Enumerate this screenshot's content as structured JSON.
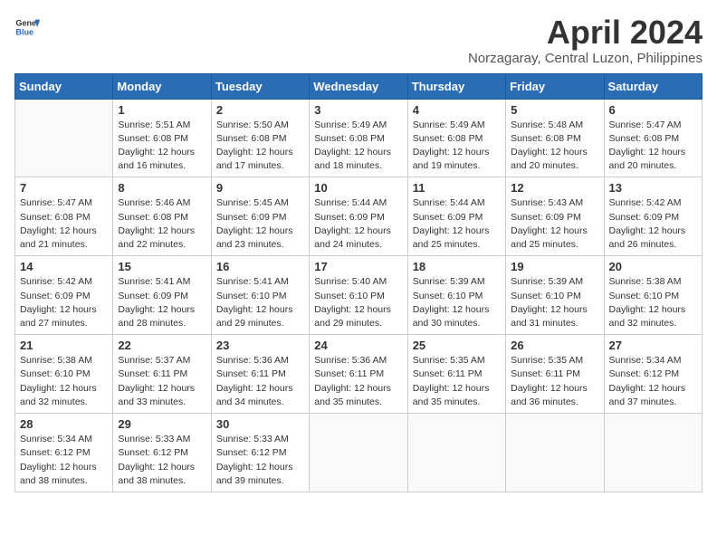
{
  "header": {
    "logo_general": "General",
    "logo_blue": "Blue",
    "month_title": "April 2024",
    "location": "Norzagaray, Central Luzon, Philippines"
  },
  "days_of_week": [
    "Sunday",
    "Monday",
    "Tuesday",
    "Wednesday",
    "Thursday",
    "Friday",
    "Saturday"
  ],
  "weeks": [
    [
      {
        "day": "",
        "info": ""
      },
      {
        "day": "1",
        "info": "Sunrise: 5:51 AM\nSunset: 6:08 PM\nDaylight: 12 hours\nand 16 minutes."
      },
      {
        "day": "2",
        "info": "Sunrise: 5:50 AM\nSunset: 6:08 PM\nDaylight: 12 hours\nand 17 minutes."
      },
      {
        "day": "3",
        "info": "Sunrise: 5:49 AM\nSunset: 6:08 PM\nDaylight: 12 hours\nand 18 minutes."
      },
      {
        "day": "4",
        "info": "Sunrise: 5:49 AM\nSunset: 6:08 PM\nDaylight: 12 hours\nand 19 minutes."
      },
      {
        "day": "5",
        "info": "Sunrise: 5:48 AM\nSunset: 6:08 PM\nDaylight: 12 hours\nand 20 minutes."
      },
      {
        "day": "6",
        "info": "Sunrise: 5:47 AM\nSunset: 6:08 PM\nDaylight: 12 hours\nand 20 minutes."
      }
    ],
    [
      {
        "day": "7",
        "info": "Sunrise: 5:47 AM\nSunset: 6:08 PM\nDaylight: 12 hours\nand 21 minutes."
      },
      {
        "day": "8",
        "info": "Sunrise: 5:46 AM\nSunset: 6:08 PM\nDaylight: 12 hours\nand 22 minutes."
      },
      {
        "day": "9",
        "info": "Sunrise: 5:45 AM\nSunset: 6:09 PM\nDaylight: 12 hours\nand 23 minutes."
      },
      {
        "day": "10",
        "info": "Sunrise: 5:44 AM\nSunset: 6:09 PM\nDaylight: 12 hours\nand 24 minutes."
      },
      {
        "day": "11",
        "info": "Sunrise: 5:44 AM\nSunset: 6:09 PM\nDaylight: 12 hours\nand 25 minutes."
      },
      {
        "day": "12",
        "info": "Sunrise: 5:43 AM\nSunset: 6:09 PM\nDaylight: 12 hours\nand 25 minutes."
      },
      {
        "day": "13",
        "info": "Sunrise: 5:42 AM\nSunset: 6:09 PM\nDaylight: 12 hours\nand 26 minutes."
      }
    ],
    [
      {
        "day": "14",
        "info": "Sunrise: 5:42 AM\nSunset: 6:09 PM\nDaylight: 12 hours\nand 27 minutes."
      },
      {
        "day": "15",
        "info": "Sunrise: 5:41 AM\nSunset: 6:09 PM\nDaylight: 12 hours\nand 28 minutes."
      },
      {
        "day": "16",
        "info": "Sunrise: 5:41 AM\nSunset: 6:10 PM\nDaylight: 12 hours\nand 29 minutes."
      },
      {
        "day": "17",
        "info": "Sunrise: 5:40 AM\nSunset: 6:10 PM\nDaylight: 12 hours\nand 29 minutes."
      },
      {
        "day": "18",
        "info": "Sunrise: 5:39 AM\nSunset: 6:10 PM\nDaylight: 12 hours\nand 30 minutes."
      },
      {
        "day": "19",
        "info": "Sunrise: 5:39 AM\nSunset: 6:10 PM\nDaylight: 12 hours\nand 31 minutes."
      },
      {
        "day": "20",
        "info": "Sunrise: 5:38 AM\nSunset: 6:10 PM\nDaylight: 12 hours\nand 32 minutes."
      }
    ],
    [
      {
        "day": "21",
        "info": "Sunrise: 5:38 AM\nSunset: 6:10 PM\nDaylight: 12 hours\nand 32 minutes."
      },
      {
        "day": "22",
        "info": "Sunrise: 5:37 AM\nSunset: 6:11 PM\nDaylight: 12 hours\nand 33 minutes."
      },
      {
        "day": "23",
        "info": "Sunrise: 5:36 AM\nSunset: 6:11 PM\nDaylight: 12 hours\nand 34 minutes."
      },
      {
        "day": "24",
        "info": "Sunrise: 5:36 AM\nSunset: 6:11 PM\nDaylight: 12 hours\nand 35 minutes."
      },
      {
        "day": "25",
        "info": "Sunrise: 5:35 AM\nSunset: 6:11 PM\nDaylight: 12 hours\nand 35 minutes."
      },
      {
        "day": "26",
        "info": "Sunrise: 5:35 AM\nSunset: 6:11 PM\nDaylight: 12 hours\nand 36 minutes."
      },
      {
        "day": "27",
        "info": "Sunrise: 5:34 AM\nSunset: 6:12 PM\nDaylight: 12 hours\nand 37 minutes."
      }
    ],
    [
      {
        "day": "28",
        "info": "Sunrise: 5:34 AM\nSunset: 6:12 PM\nDaylight: 12 hours\nand 38 minutes."
      },
      {
        "day": "29",
        "info": "Sunrise: 5:33 AM\nSunset: 6:12 PM\nDaylight: 12 hours\nand 38 minutes."
      },
      {
        "day": "30",
        "info": "Sunrise: 5:33 AM\nSunset: 6:12 PM\nDaylight: 12 hours\nand 39 minutes."
      },
      {
        "day": "",
        "info": ""
      },
      {
        "day": "",
        "info": ""
      },
      {
        "day": "",
        "info": ""
      },
      {
        "day": "",
        "info": ""
      }
    ]
  ]
}
